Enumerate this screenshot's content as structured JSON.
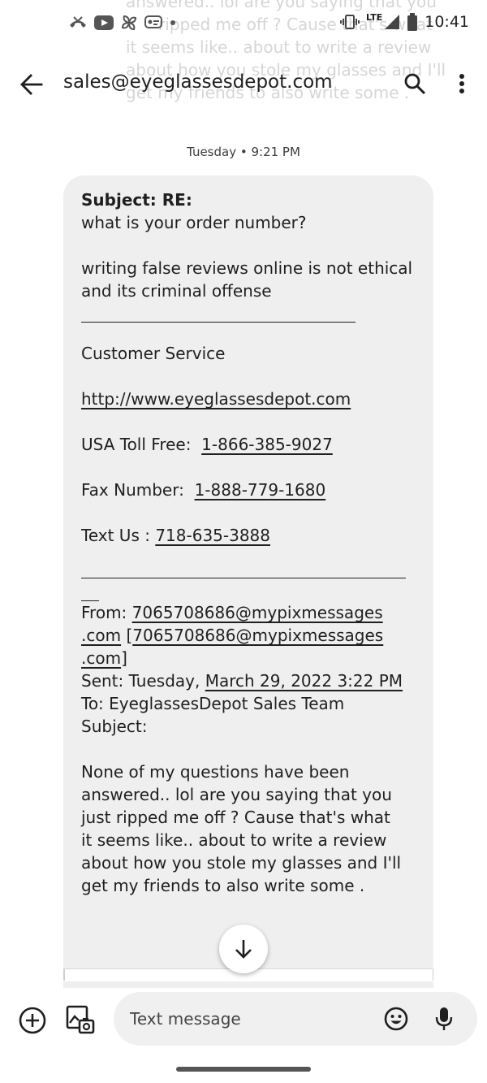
{
  "status_bar": {
    "time": "10:41",
    "network": "LTE",
    "icons": [
      "missed-call-icon",
      "youtube-icon",
      "pinwheel-icon",
      "message-icon",
      "dot-icon",
      "vibrate-icon",
      "signal-icon",
      "battery-icon"
    ]
  },
  "ghost_text": [
    "answered.. lol are you saying that you",
    "ripped me off ? Cause that's what",
    "it seems like.. about to write a review",
    "about how you stole my glasses and I'll",
    "get my friends to also write some ."
  ],
  "app_bar": {
    "title": "sales@eyeglassesdepot.com",
    "icons": [
      "back-arrow-icon",
      "search-icon",
      "more-vert-icon"
    ]
  },
  "conversation": {
    "timestamp": "Tuesday • 9:21 PM"
  },
  "message": {
    "subject_line": "Subject: RE:",
    "question": "what is your order number?",
    "warning_line1": "writing false reviews online is not ethical",
    "warning_line2": "and its criminal offense",
    "signature_name": "Customer Service",
    "website": "http://www.eyeglassesdepot.com",
    "toll_free_label": "USA Toll Free:",
    "toll_free_number": "1-866-385-9027",
    "fax_label": "Fax Number:",
    "fax_number": "1-888-779-1680",
    "text_label": "Text Us :",
    "text_number": "718-635-3888",
    "from_label": "From:",
    "from_email_part1": "7065708686@mypixmessages",
    "from_email_part2": ".com",
    "from_bracket_open": "[",
    "from_bracket_email_part1": "7065708686@mypixmessages",
    "from_bracket_email_part2": ".com",
    "from_bracket_close": "]",
    "sent_label": "Sent: Tuesday,",
    "sent_date": "March 29, 2022 3:22 PM",
    "to_line": "To: EyeglassesDepot Sales Team",
    "subject_empty": "Subject:",
    "body_lines": [
      "None of my questions have been",
      "answered.. lol are you saying that you",
      "just ripped me off ? Cause that's what",
      "it seems like.. about to write a review",
      "about how you stole my glasses and I'll",
      "get my friends to also write some ."
    ]
  },
  "compose": {
    "placeholder": "Text message",
    "icons": [
      "add-circle-icon",
      "gallery-icon",
      "emoji-icon",
      "mic-icon",
      "arrow-down-icon"
    ]
  }
}
